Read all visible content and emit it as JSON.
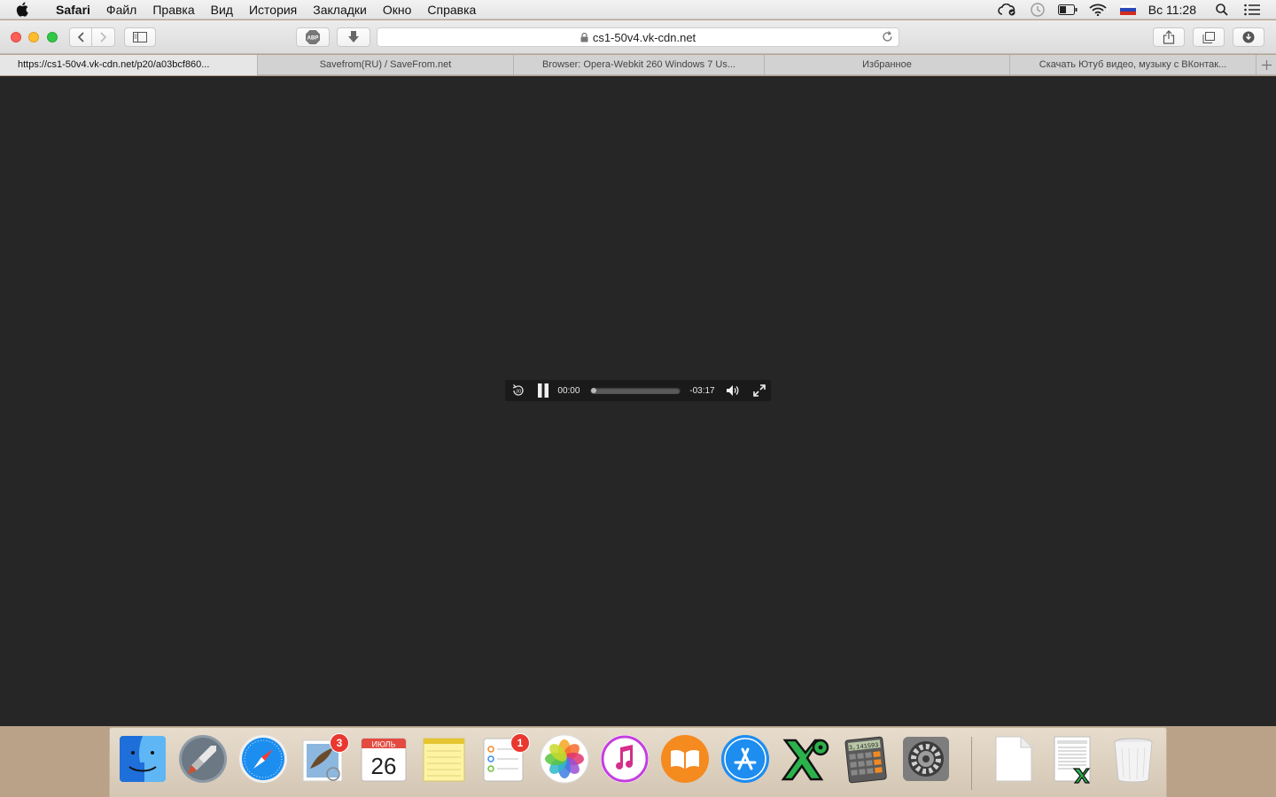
{
  "menubar": {
    "app_name": "Safari",
    "items": [
      "Файл",
      "Правка",
      "Вид",
      "История",
      "Закладки",
      "Окно",
      "Справка"
    ],
    "clock": "Вс 11:28"
  },
  "toolbar": {
    "address": "cs1-50v4.vk-cdn.net"
  },
  "tabs": [
    {
      "label": "https://cs1-50v4.vk-cdn.net/p20/a03bcf860...",
      "active": true
    },
    {
      "label": "Savefrom(RU) / SaveFrom.net",
      "active": false
    },
    {
      "label": "Browser: Opera-Webkit 260 Windows 7 Us...",
      "active": false
    },
    {
      "label": "Избранное",
      "active": false
    },
    {
      "label": "Скачать Ютуб видео, музыку с ВКонтак...",
      "active": false
    }
  ],
  "player": {
    "elapsed": "00:00",
    "remaining": "-03:17",
    "progress": 0.0
  },
  "dock": {
    "calendar_month": "ИЮЛЬ",
    "calendar_day": "26",
    "mail_badge": "3",
    "reminders_badge": "1",
    "calculator_display": "3,141593"
  }
}
